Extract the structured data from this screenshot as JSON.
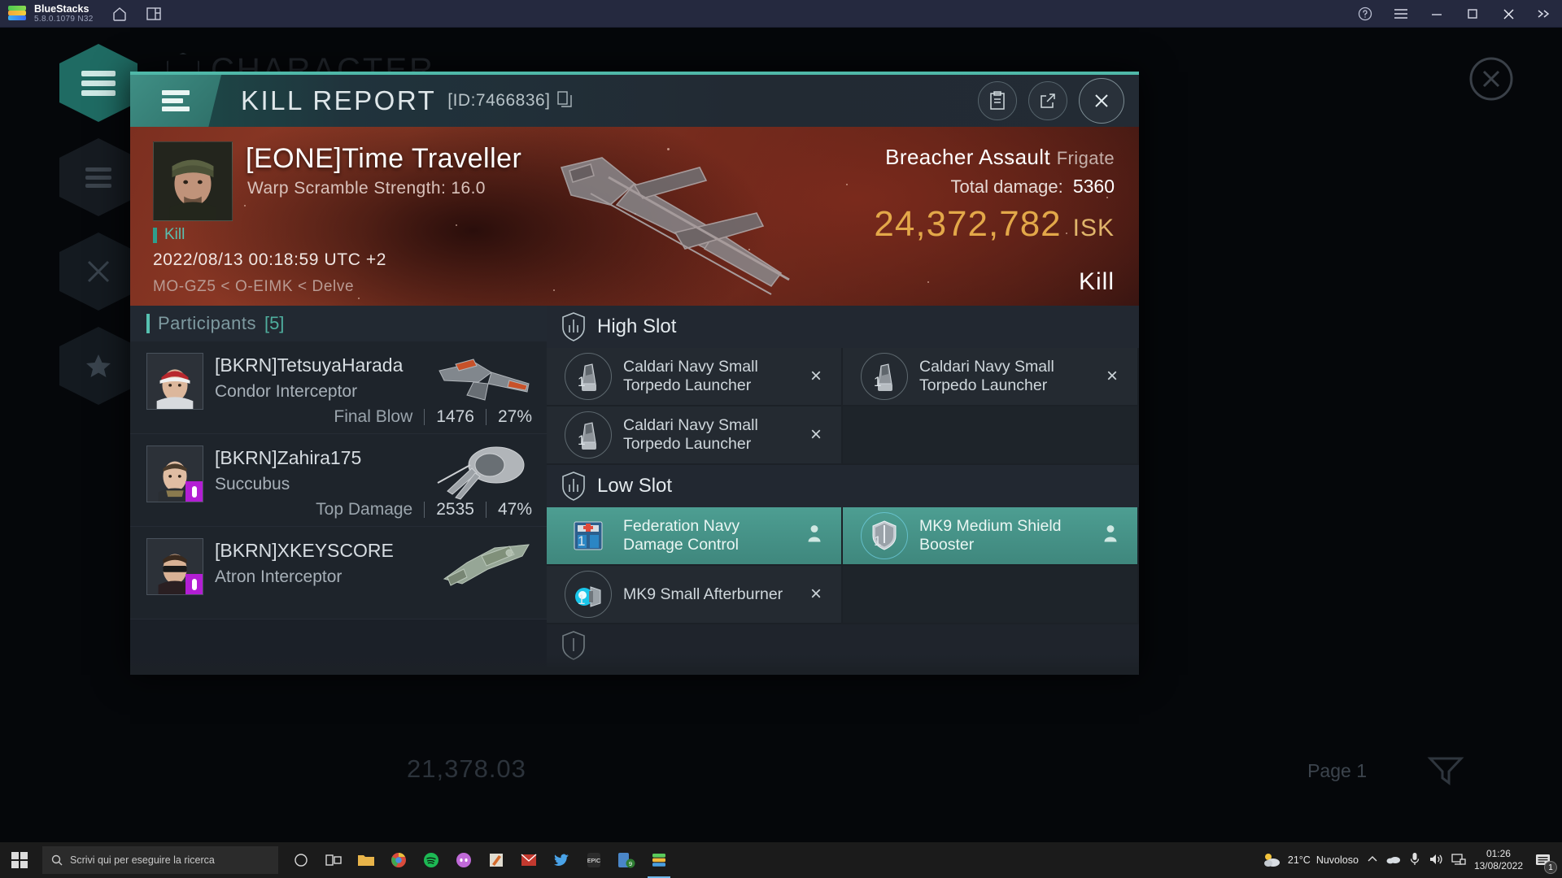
{
  "window": {
    "app_name": "BlueStacks",
    "version": "5.8.0.1079  N32",
    "icons": {
      "home": "home-icon",
      "multi_instance": "multi-instance-icon",
      "help": "help-icon",
      "menu": "menu-icon",
      "minimize": "minimize-icon",
      "maximize": "maximize-icon",
      "close": "close-icon",
      "collapse": "collapse-icon"
    }
  },
  "background": {
    "page_title": "CHARACTER",
    "bottom_value": "21,378.03",
    "page_label": "Page 1"
  },
  "modal": {
    "title": "KILL REPORT",
    "id_label": "[ID:7466836]",
    "actions": {
      "copy": "copy-icon",
      "report": "clipboard-icon",
      "share": "share-icon",
      "close": "close-icon"
    }
  },
  "banner": {
    "victim_name": "[EONE]Time Traveller",
    "subtitle": "Warp Scramble Strength: 16.0",
    "result_tag": "Kill",
    "timestamp": "2022/08/13 00:18:59 UTC +2",
    "location": "MO-GZ5 < O-EIMK < Delve",
    "ship_name": "Breacher Assault",
    "ship_class": "Frigate",
    "total_damage_label": "Total damage:",
    "total_damage_value": "5360",
    "isk_value": "24,372,782",
    "isk_unit": "ISK",
    "result_word": "Kill",
    "accent_isk": "#e3a849",
    "accent_teal": "#2f9e8c"
  },
  "participants": {
    "header_label": "Participants",
    "count_label": "[5]",
    "rows": [
      {
        "name": "[BKRN]TetsuyaHarada",
        "ship": "Condor Interceptor",
        "stat_label": "Final Blow",
        "damage": "1476",
        "percent": "27%",
        "has_badge": false
      },
      {
        "name": "[BKRN]Zahira175",
        "ship": "Succubus",
        "stat_label": "Top Damage",
        "damage": "2535",
        "percent": "47%",
        "has_badge": true
      },
      {
        "name": "[BKRN]XKEYSCORE",
        "ship": "Atron Interceptor",
        "stat_label": "",
        "damage": "",
        "percent": "",
        "has_badge": true
      }
    ]
  },
  "fitting": {
    "high_slot": {
      "title": "High Slot",
      "icon": "shield-slot-icon",
      "modules": [
        {
          "name": "Caldari Navy Small Torpedo Launcher",
          "qty": "1",
          "action": "×",
          "highlight": false,
          "icon": "torpedo-launcher-icon"
        },
        {
          "name": "Caldari Navy Small Torpedo Launcher",
          "qty": "1",
          "action": "×",
          "highlight": false,
          "icon": "torpedo-launcher-icon"
        },
        {
          "name": "Caldari Navy Small Torpedo Launcher",
          "qty": "1",
          "action": "×",
          "highlight": false,
          "icon": "torpedo-launcher-icon"
        },
        {
          "name": "",
          "qty": "",
          "action": "",
          "highlight": false,
          "icon": ""
        }
      ]
    },
    "low_slot": {
      "title": "Low Slot",
      "icon": "shield-slot-icon",
      "modules": [
        {
          "name": "Federation Navy Damage Control",
          "qty": "1",
          "action": "person",
          "highlight": true,
          "icon": "damage-control-icon"
        },
        {
          "name": "MK9 Medium Shield Booster",
          "qty": "1",
          "action": "person",
          "highlight": true,
          "icon": "shield-booster-icon"
        },
        {
          "name": "MK9 Small Afterburner",
          "qty": "1",
          "action": "×",
          "highlight": false,
          "icon": "afterburner-icon"
        },
        {
          "name": "",
          "qty": "",
          "action": "",
          "highlight": false,
          "icon": ""
        }
      ]
    }
  },
  "taskbar": {
    "search_placeholder": "Scrivi qui per eseguire la ricerca",
    "weather_temp": "21°C",
    "weather_desc": "Nuvoloso",
    "clock_time": "01:26",
    "clock_date": "13/08/2022",
    "notification_count": "1",
    "app_badge_count": "9"
  }
}
